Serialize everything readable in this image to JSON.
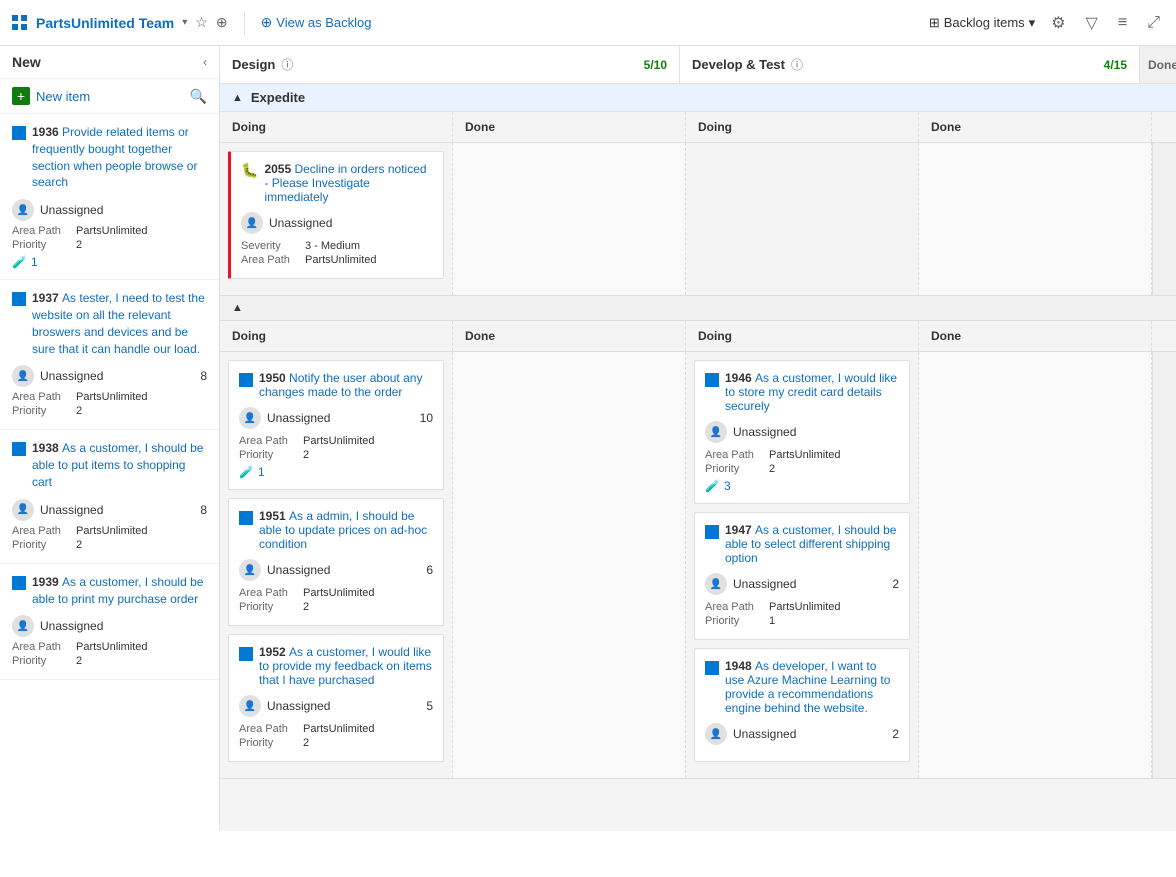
{
  "header": {
    "team_name": "PartsUnlimited Team",
    "view_backlog": "View as Backlog",
    "backlog_items": "Backlog items",
    "grid_icon": "⊞",
    "chevron": "∨",
    "star": "☆",
    "people": "⚇"
  },
  "new_column": {
    "label": "New",
    "new_item_label": "New item",
    "items": [
      {
        "id": "1936",
        "title": "Provide related items or frequently bought together section when people browse or search",
        "assignee": "Unassigned",
        "area_path": "PartsUnlimited",
        "priority": "2",
        "test_count": "1"
      },
      {
        "id": "1937",
        "title": "As tester, I need to test the website on all the relevant broswers and devices and be sure that it can handle our load.",
        "assignee": "Unassigned",
        "count": "8",
        "area_path": "PartsUnlimited",
        "priority": "2"
      },
      {
        "id": "1938",
        "title": "As a customer, I should be able to put items to shopping cart",
        "assignee": "Unassigned",
        "count": "8",
        "area_path": "PartsUnlimited",
        "priority": "2"
      },
      {
        "id": "1939",
        "title": "As a customer, I should be able to print my purchase order",
        "assignee": "Unassigned",
        "count": "",
        "area_path": "PartsUnlimited",
        "priority": "2"
      }
    ]
  },
  "design_col": {
    "label": "Design",
    "count": "5/10"
  },
  "devtest_col": {
    "label": "Develop & Test",
    "count": "4/15"
  },
  "expedite": {
    "label": "Expedite",
    "design_doing": [
      {
        "id": "2055",
        "title": "Decline in orders noticed - Please Investigate immediately",
        "assignee": "Unassigned",
        "severity": "3 - Medium",
        "area_path": "PartsUnlimited",
        "type": "bug"
      }
    ],
    "design_done": [],
    "devtest_doing": [],
    "devtest_done": []
  },
  "default_swimlane": {
    "design_doing": [
      {
        "id": "1950",
        "title": "Notify the user about any changes made to the order",
        "assignee": "Unassigned",
        "count": "10",
        "area_path": "PartsUnlimited",
        "priority": "2",
        "test_count": "1"
      },
      {
        "id": "1951",
        "title": "As a admin, I should be able to update prices on ad-hoc condition",
        "assignee": "Unassigned",
        "count": "6",
        "area_path": "PartsUnlimited",
        "priority": "2"
      },
      {
        "id": "1952",
        "title": "As a customer, I would like to provide my feedback on items that I have purchased",
        "assignee": "Unassigned",
        "count": "5",
        "area_path": "PartsUnlimited",
        "priority": "2"
      }
    ],
    "design_done": [],
    "devtest_doing": [
      {
        "id": "1946",
        "title": "As a customer, I would like to store my credit card details securely",
        "assignee": "Unassigned",
        "count": "",
        "area_path": "PartsUnlimited",
        "priority": "2",
        "test_count": "3"
      },
      {
        "id": "1947",
        "title": "As a customer, I should be able to select different shipping option",
        "assignee": "Unassigned",
        "count": "2",
        "area_path": "PartsUnlimited",
        "priority": "1"
      },
      {
        "id": "1948",
        "title": "As developer, I want to use Azure Machine Learning to provide a recommendations engine behind the website.",
        "assignee": "Unassigned",
        "count": "2",
        "area_path": "PartsUnlimited",
        "priority": ""
      }
    ],
    "devtest_done": []
  },
  "labels": {
    "doing": "Doing",
    "done": "Done",
    "area_path": "Area Path",
    "priority": "Priority",
    "severity": "Severity",
    "unassigned": "Unassigned"
  }
}
